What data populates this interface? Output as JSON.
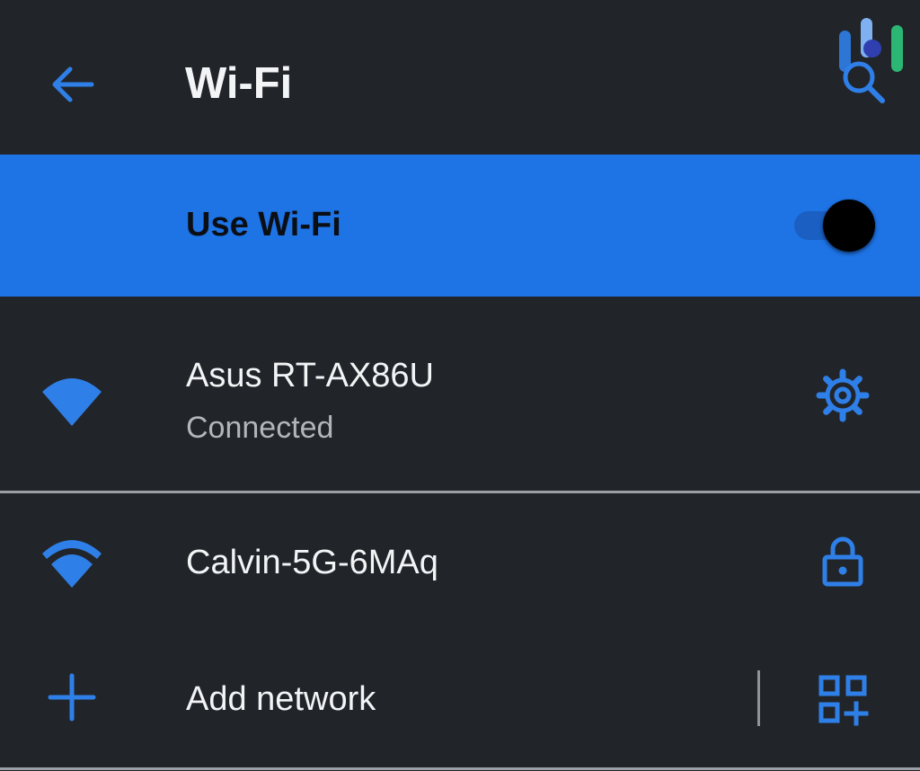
{
  "header": {
    "title": "Wi-Fi",
    "back_icon": "arrow-back-icon",
    "search_icon": "search-icon"
  },
  "use_wifi": {
    "label": "Use Wi-Fi",
    "toggle_on": true
  },
  "networks": [
    {
      "name": "Asus RT-AX86U",
      "status": "Connected",
      "icon": "wifi-full-icon",
      "action_icon": "gear-icon"
    },
    {
      "name": "Calvin-5G-6MAq",
      "icon": "wifi-icon",
      "action_icon": "lock-icon"
    }
  ],
  "add_network": {
    "label": "Add network",
    "icon": "plus-icon",
    "action_icon": "qr-code-scan-icon"
  },
  "colors": {
    "background": "#212529",
    "accent": "#1e73e5",
    "text_primary": "#f3f4f6",
    "text_secondary": "#b0b6bc"
  }
}
